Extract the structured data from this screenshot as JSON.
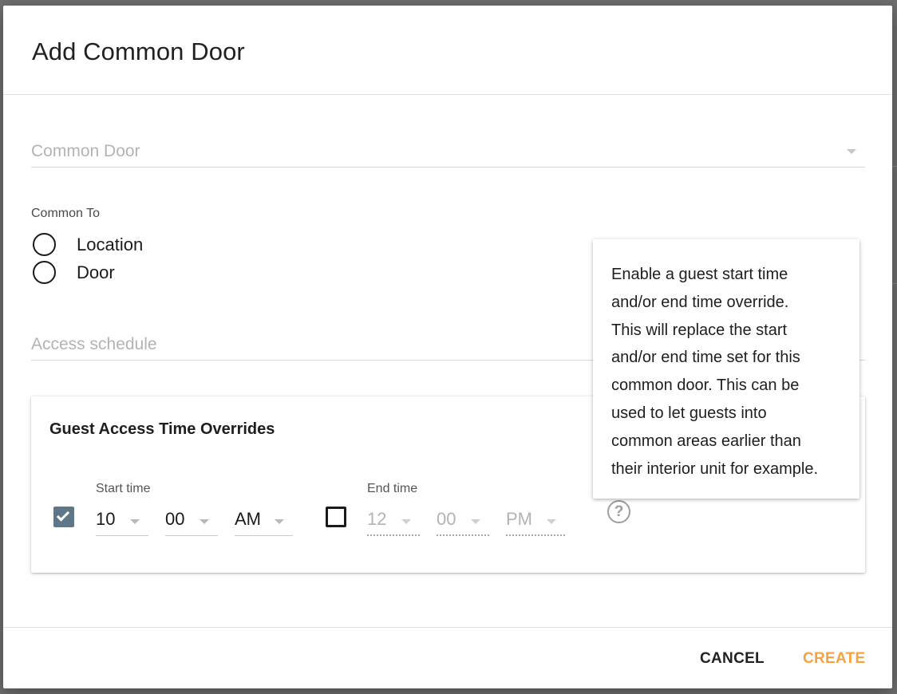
{
  "dialog": {
    "title": "Add Common Door"
  },
  "common_door_field": {
    "placeholder": "Common Door"
  },
  "common_to": {
    "label": "Common To",
    "options": [
      {
        "label": "Location",
        "selected": false
      },
      {
        "label": "Door",
        "selected": false
      }
    ]
  },
  "access_schedule_field": {
    "placeholder": "Access schedule"
  },
  "overrides": {
    "title": "Guest Access Time Overrides",
    "start": {
      "label": "Start time",
      "checked": true,
      "hour": "10",
      "minute": "00",
      "ampm": "AM"
    },
    "end": {
      "label": "End time",
      "checked": false,
      "hour": "12",
      "minute": "00",
      "ampm": "PM"
    }
  },
  "help": {
    "icon": "question-circle-icon",
    "tooltip_lines": [
      "Enable a guest start time",
      "and/or end time override.",
      "This will replace the start",
      "and/or end time set for this",
      "common door. This can be",
      "used to let guests into",
      "common areas earlier than",
      "their interior unit for example."
    ]
  },
  "actions": {
    "cancel_label": "CANCEL",
    "create_label": "CREATE",
    "create_color": "#f5a340",
    "cancel_color": "#212121",
    "checkbox_color": "#5e7788"
  }
}
